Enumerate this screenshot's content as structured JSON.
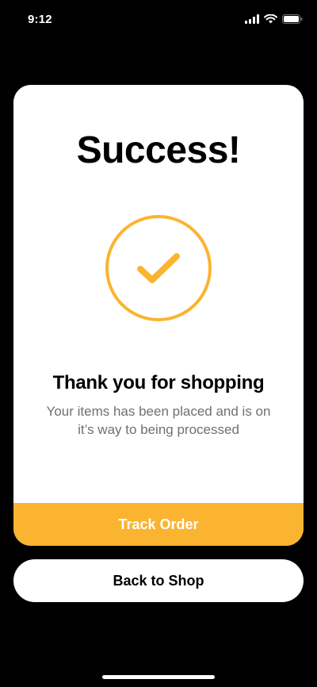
{
  "status_bar": {
    "time": "9:12",
    "icons": [
      "signal-icon",
      "wifi-icon",
      "battery-icon"
    ]
  },
  "card": {
    "title": "Success!",
    "icon": "checkmark-circle-icon",
    "heading": "Thank you for shopping",
    "message": "Your items has been placed and is on it’s way to being processed",
    "track_button_label": "Track Order"
  },
  "back_button_label": "Back to Shop",
  "colors": {
    "accent": "#fbb430",
    "background": "#000000",
    "card": "#ffffff",
    "muted_text": "#707070"
  }
}
